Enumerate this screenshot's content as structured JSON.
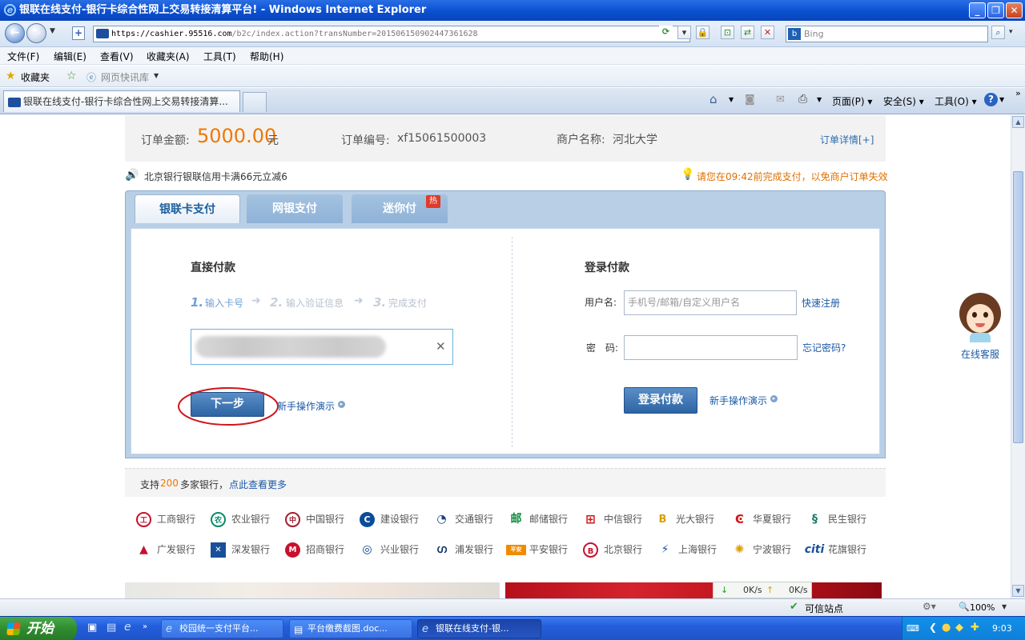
{
  "window": {
    "title": "银联在线支付-银行卡综合性网上交易转接清算平台! - Windows Internet Explorer"
  },
  "address_bar": {
    "url_scheme": "https://",
    "url_host": "cashier.95516.com",
    "url_path": "/b2c/index.action?transNumber=201506150902447361628",
    "search_placeholder": "Bing"
  },
  "menu_bar": {
    "items": [
      "文件(F)",
      "编辑(E)",
      "查看(V)",
      "收藏夹(A)",
      "工具(T)",
      "帮助(H)"
    ]
  },
  "favorites_bar": {
    "favorites_label": "收藏夹",
    "quick_news_label": "网页快讯库"
  },
  "tabs": {
    "active_tab_title": "银联在线支付-银行卡综合性网上交易转接清算..."
  },
  "command_bar": {
    "page_label": "页面(P)",
    "safety_label": "安全(S)",
    "tools_label": "工具(O)"
  },
  "order": {
    "amount_label": "订单金额:",
    "amount_value": "5000.00",
    "amount_unit": "元",
    "number_label": "订单编号:",
    "number_value": "xf15061500003",
    "merchant_label": "商户名称:",
    "merchant_value": "河北大学",
    "details_link": "订单详情[+]"
  },
  "notices": {
    "promo": "北京银行银联信用卡满66元立减6",
    "deadline": "请您在09:42前完成支付，以免商户订单失效"
  },
  "payment_tabs": {
    "tab1": "银联卡支付",
    "tab2": "网银支付",
    "tab3": "迷你付",
    "hot_badge": "热"
  },
  "direct_pay": {
    "heading": "直接付款",
    "step1_num": "1.",
    "step1": "输入卡号",
    "step2_num": "2.",
    "step2": "输入验证信息",
    "step3_num": "3.",
    "step3": "完成支付",
    "next_button": "下一步",
    "demo_link": "新手操作演示"
  },
  "login_pay": {
    "heading": "登录付款",
    "username_label": "用户名:",
    "username_placeholder": "手机号/邮箱/自定义用户名",
    "register_link": "快速注册",
    "password_label": "密　码:",
    "forgot_link": "忘记密码?",
    "login_button": "登录付款",
    "demo_link": "新手操作演示"
  },
  "banks": {
    "support_prefix": "支持",
    "support_count": "200",
    "support_suffix": "多家银行，",
    "more_link": "点此查看更多",
    "row1": [
      "工商银行",
      "农业银行",
      "中国银行",
      "建设银行",
      "交通银行",
      "邮储银行",
      "中信银行",
      "光大银行",
      "华夏银行",
      "民生银行"
    ],
    "row2": [
      "广发银行",
      "深发银行",
      "招商银行",
      "兴业银行",
      "浦发银行",
      "平安银行",
      "北京银行",
      "上海银行",
      "宁波银行",
      "花旗银行"
    ]
  },
  "service": {
    "label": "在线客服"
  },
  "speed_widget": {
    "down": "0K/s",
    "up": "0K/s"
  },
  "status_bar": {
    "zone": "可信站点",
    "zoom": "100%"
  },
  "taskbar": {
    "start": "开始",
    "task1": "校园统一支付平台...",
    "task2": "平台缴费截图.doc...",
    "task3": "银联在线支付-银...",
    "clock": "9:03"
  },
  "colors": {
    "amount": "#f07800",
    "link": "#1a5aa6",
    "deadline": "#e07000",
    "annotation_circle": "#d0161b"
  }
}
